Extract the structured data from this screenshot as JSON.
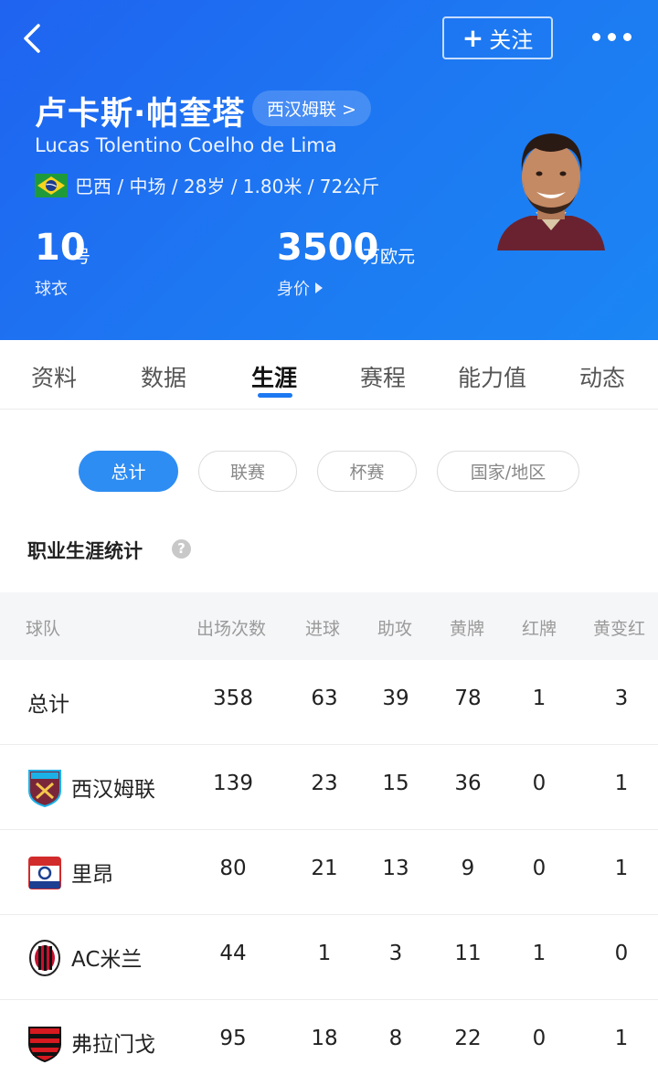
{
  "header": {
    "follow_label": "关注",
    "name": "卢卡斯·帕奎塔",
    "club_chip": "西汉姆联 >",
    "full_name": "Lucas Tolentino Coelho de Lima",
    "meta": "巴西 / 中场 / 28岁 / 1.80米 / 72公斤",
    "shirt_number": "10",
    "shirt_number_unit": "号",
    "shirt_label": "球衣",
    "market_value": "3500",
    "market_value_unit": "万欧元",
    "market_value_label": "身价",
    "colors": {
      "primary": "#1d79f2"
    }
  },
  "tabs": [
    "资料",
    "数据",
    "生涯",
    "赛程",
    "能力值",
    "动态"
  ],
  "active_tab": "生涯",
  "filters": [
    "总计",
    "联赛",
    "杯赛",
    "国家/地区"
  ],
  "section_title": "职业生涯统计",
  "table": {
    "columns": [
      "球队",
      "出场次数",
      "进球",
      "助攻",
      "黄牌",
      "红牌",
      "黄变红"
    ],
    "rows": [
      {
        "team": "总计",
        "badge": "",
        "values": [
          "358",
          "63",
          "39",
          "78",
          "1",
          "3"
        ]
      },
      {
        "team": "西汉姆联",
        "badge": "west-ham-badge-icon",
        "values": [
          "139",
          "23",
          "15",
          "36",
          "0",
          "1"
        ]
      },
      {
        "team": "里昂",
        "badge": "lyon-badge-icon",
        "values": [
          "80",
          "21",
          "13",
          "9",
          "0",
          "1"
        ]
      },
      {
        "team": "AC米兰",
        "badge": "ac-milan-badge-icon",
        "values": [
          "44",
          "1",
          "3",
          "11",
          "1",
          "0"
        ]
      },
      {
        "team": "弗拉门戈",
        "badge": "flamengo-badge-icon",
        "values": [
          "95",
          "18",
          "8",
          "22",
          "0",
          "1"
        ]
      }
    ]
  }
}
